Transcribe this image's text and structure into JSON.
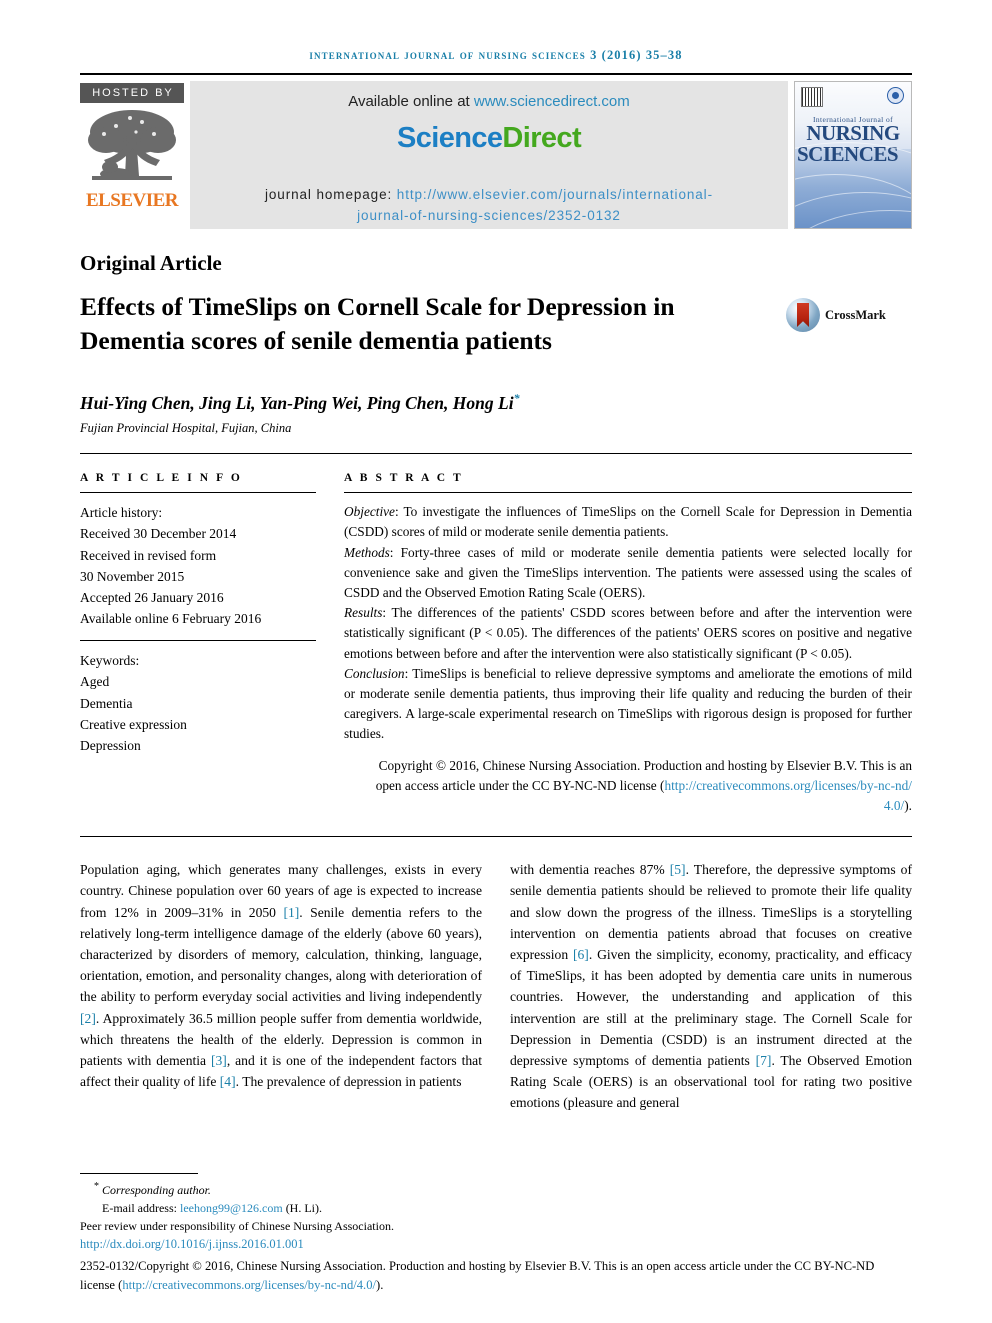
{
  "running_head": "International Journal of Nursing Sciences 3 (2016) 35–38",
  "masthead": {
    "hosted_by": "HOSTED BY",
    "elsevier_wordmark": "ELSEVIER",
    "available_online_label": "Available online at",
    "sciencedirect_url": "www.sciencedirect.com",
    "sciencedirect_logo_part1": "Science",
    "sciencedirect_logo_part2": "Direct",
    "journal_homepage_label": "journal homepage:",
    "journal_homepage_url_line1": "http://www.elsevier.com/journals/international-",
    "journal_homepage_url_line2": "journal-of-nursing-sciences/2352-0132",
    "cover": {
      "subtitle": "International Journal of",
      "title_line1": "NURSING",
      "title_line2": "SCIENCES"
    },
    "colors": {
      "link_blue": "#3d8fc6",
      "science_blue": "#1c7fc4",
      "direct_green": "#44a81e",
      "elsevier_orange": "#e87722",
      "panel_grey": "#e4e4e4",
      "hosted_grey": "#555555"
    }
  },
  "article": {
    "type": "Original Article",
    "title": "Effects of TimeSlips on Cornell Scale for Depression in Dementia scores of senile dementia patients",
    "crossmark_label": "CrossMark",
    "authors": "Hui-Ying Chen, Jing Li, Yan-Ping Wei, Ping Chen, Hong Li",
    "corresponding_marker": "*",
    "affiliation": "Fujian Provincial Hospital, Fujian, China"
  },
  "article_info": {
    "heading": "A R T I C L E   I N F O",
    "history_label": "Article history:",
    "history": [
      "Received 30 December 2014",
      "Received in revised form",
      "30 November 2015",
      "Accepted 26 January 2016",
      "Available online 6 February 2016"
    ],
    "keywords_label": "Keywords:",
    "keywords": [
      "Aged",
      "Dementia",
      "Creative expression",
      "Depression"
    ]
  },
  "abstract": {
    "heading": "A B S T R A C T",
    "objective_label": "Objective",
    "objective_text": ": To investigate the influences of TimeSlips on the Cornell Scale for Depression in Dementia (CSDD) scores of mild or moderate senile dementia patients.",
    "methods_label": "Methods",
    "methods_text": ": Forty-three cases of mild or moderate senile dementia patients were selected locally for convenience sake and given the TimeSlips intervention. The patients were assessed using the scales of CSDD and the Observed Emotion Rating Scale (OERS).",
    "results_label": "Results",
    "results_text": ": The differences of the patients' CSDD scores between before and after the intervention were statistically significant (P < 0.05). The differences of the patients' OERS scores on positive and negative emotions between before and after the intervention were also statistically significant (P < 0.05).",
    "conclusion_label": "Conclusion",
    "conclusion_text": ": TimeSlips is beneficial to relieve depressive symptoms and ameliorate the emotions of mild or moderate senile dementia patients, thus improving their life quality and reducing the burden of their caregivers. A large-scale experimental research on TimeSlips with rigorous design is proposed for further studies.",
    "copyright_line": "Copyright © 2016, Chinese Nursing Association. Production and hosting by Elsevier B.V. This is an open access article under the CC BY-NC-ND license (",
    "copyright_url": "http://creativecommons.org/licenses/by-nc-nd/4.0/",
    "copyright_close": ")."
  },
  "body": {
    "left_column": {
      "p1_a": "Population aging, which generates many challenges, exists in every country. Chinese population over 60 years of age is expected to increase from 12% in 2009–31% in 2050 ",
      "ref1": "[1]",
      "p1_b": ". Senile dementia refers to the relatively long-term intelligence damage of the elderly (above 60 years), characterized by disorders of memory, calculation, thinking, language, orientation, emotion, and personality changes, along with deterioration of the ability to perform everyday social activities and living independently ",
      "ref2": "[2]",
      "p1_c": ". Approximately 36.5 million people suffer from dementia worldwide, which threatens the health of the elderly. Depression is common in patients with dementia ",
      "ref3": "[3]",
      "p1_d": ", and it is one of the independent factors that affect their quality of life ",
      "ref4": "[4]",
      "p1_e": ". The prevalence of depression in patients"
    },
    "right_column": {
      "p2_a": "with dementia reaches 87% ",
      "ref5": "[5]",
      "p2_b": ". Therefore, the depressive symptoms of senile dementia patients should be relieved to promote their life quality and slow down the progress of the illness. TimeSlips is a storytelling intervention on dementia patients abroad that focuses on creative expression ",
      "ref6": "[6]",
      "p2_c": ". Given the simplicity, economy, practicality, and efficacy of TimeSlips, it has been adopted by dementia care units in numerous countries. However, the understanding and application of this intervention are still at the preliminary stage. The Cornell Scale for Depression in Dementia (CSDD) is an instrument directed at the depressive symptoms of dementia patients ",
      "ref7": "[7]",
      "p2_d": ". The Observed Emotion Rating Scale (OERS) is an observational tool for rating two positive emotions (pleasure and general"
    }
  },
  "footnote": {
    "corresponding_marker": "*",
    "corresponding_author": "Corresponding author.",
    "email_label": "E-mail address:",
    "email": "leehong99@126.com",
    "email_suffix": "(H. Li).",
    "peer_review": "Peer review under responsibility of Chinese Nursing Association.",
    "doi": "http://dx.doi.org/10.1016/j.ijnss.2016.01.001",
    "final_line_a": "2352-0132/Copyright © 2016, Chinese Nursing Association. Production and hosting by Elsevier B.V. This is an open access article under the CC BY-NC-ND license (",
    "final_url": "http://creativecommons.org/licenses/by-nc-nd/4.0/",
    "final_line_b": ")."
  }
}
